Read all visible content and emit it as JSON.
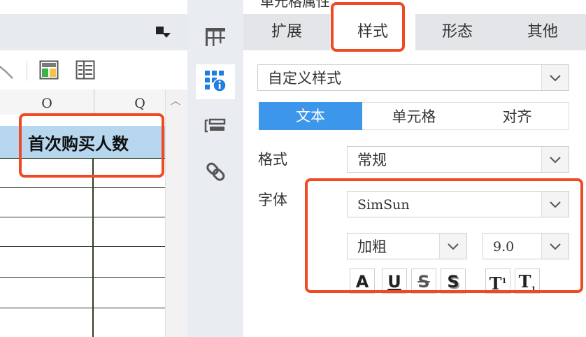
{
  "panel": {
    "title": "单元格属性",
    "tabs": [
      {
        "label": "扩展"
      },
      {
        "label": "样式"
      },
      {
        "label": "形态"
      },
      {
        "label": "其他"
      }
    ],
    "active_tab": "样式",
    "style_select": {
      "value": "自定义样式"
    },
    "sub_tabs": [
      {
        "label": "文本"
      },
      {
        "label": "单元格"
      },
      {
        "label": "对齐"
      }
    ],
    "active_sub_tab": "文本",
    "format": {
      "label": "格式",
      "value": "常规"
    },
    "font": {
      "label": "字体",
      "family": "SimSun",
      "weight": "加粗",
      "size": "9.0",
      "buttons": [
        {
          "glyph": "A",
          "name": "font-color-button"
        },
        {
          "glyph": "U",
          "name": "underline-button"
        },
        {
          "glyph": "S",
          "name": "strikethrough-button"
        },
        {
          "glyph": "S",
          "name": "shadow-button"
        },
        {
          "glyph": "T",
          "name": "superscript-button"
        },
        {
          "glyph": "T",
          "name": "subscript-button"
        }
      ]
    }
  },
  "sheet": {
    "columns": [
      "O",
      "Q"
    ],
    "header_cell": "首次购买人数"
  },
  "colors": {
    "accent": "#3c97ea",
    "highlight": "#ef4a24",
    "header_cell_bg": "#b7d7ef"
  },
  "sidebar_icons": [
    "grid-layout-icon",
    "cell-properties-icon",
    "widget-settings-icon",
    "link-icon"
  ]
}
